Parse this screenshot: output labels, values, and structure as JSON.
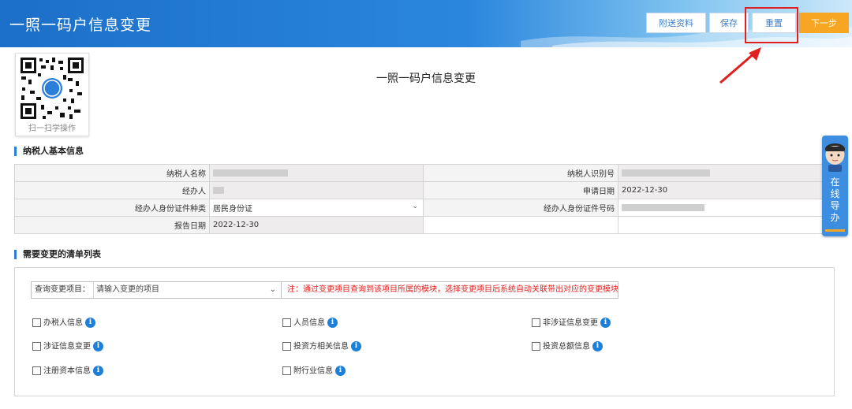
{
  "header": {
    "title": "一照一码户信息变更",
    "buttons": [
      {
        "label": "附送资料"
      },
      {
        "label": "保存"
      },
      {
        "label": "重置"
      },
      {
        "label": "下一步"
      }
    ]
  },
  "qr": {
    "caption": "扫一扫学操作"
  },
  "page_title": "一照一码户信息变更",
  "basic_info": {
    "section_title": "纳税人基本信息",
    "rows": [
      {
        "l1": "纳税人名称",
        "v1": "",
        "l2": "纳税人识别号",
        "v2": ""
      },
      {
        "l1": "经办人",
        "v1": "",
        "l2": "申请日期",
        "v2": "2022-12-30"
      },
      {
        "l1": "经办人身份证件种类",
        "v1": "居民身份证",
        "l2": "经办人身份证件号码",
        "v2": ""
      },
      {
        "l1": "报告日期",
        "v1": "2022-12-30",
        "l2": "",
        "v2": ""
      }
    ]
  },
  "change_list": {
    "section_title": "需要变更的清单列表",
    "query_label": "查询变更项目：",
    "query_placeholder": "请输入变更的项目",
    "note": "注：通过变更项目查询到该项目所属的模块，选择变更项目后系统自动关联带出对应的变更模块。",
    "items": [
      {
        "label": "办税人信息"
      },
      {
        "label": "人员信息"
      },
      {
        "label": "非涉证信息变更"
      },
      {
        "label": "涉证信息变更"
      },
      {
        "label": "投资方相关信息"
      },
      {
        "label": "投资总额信息"
      },
      {
        "label": "注册资本信息"
      },
      {
        "label": "附行业信息"
      }
    ]
  },
  "online_help": {
    "label": "在线导办"
  },
  "colors": {
    "accent": "#2b7fd8",
    "next_button": "#f6a623",
    "note_red": "#e02020",
    "highlight_box": "#e02020"
  }
}
